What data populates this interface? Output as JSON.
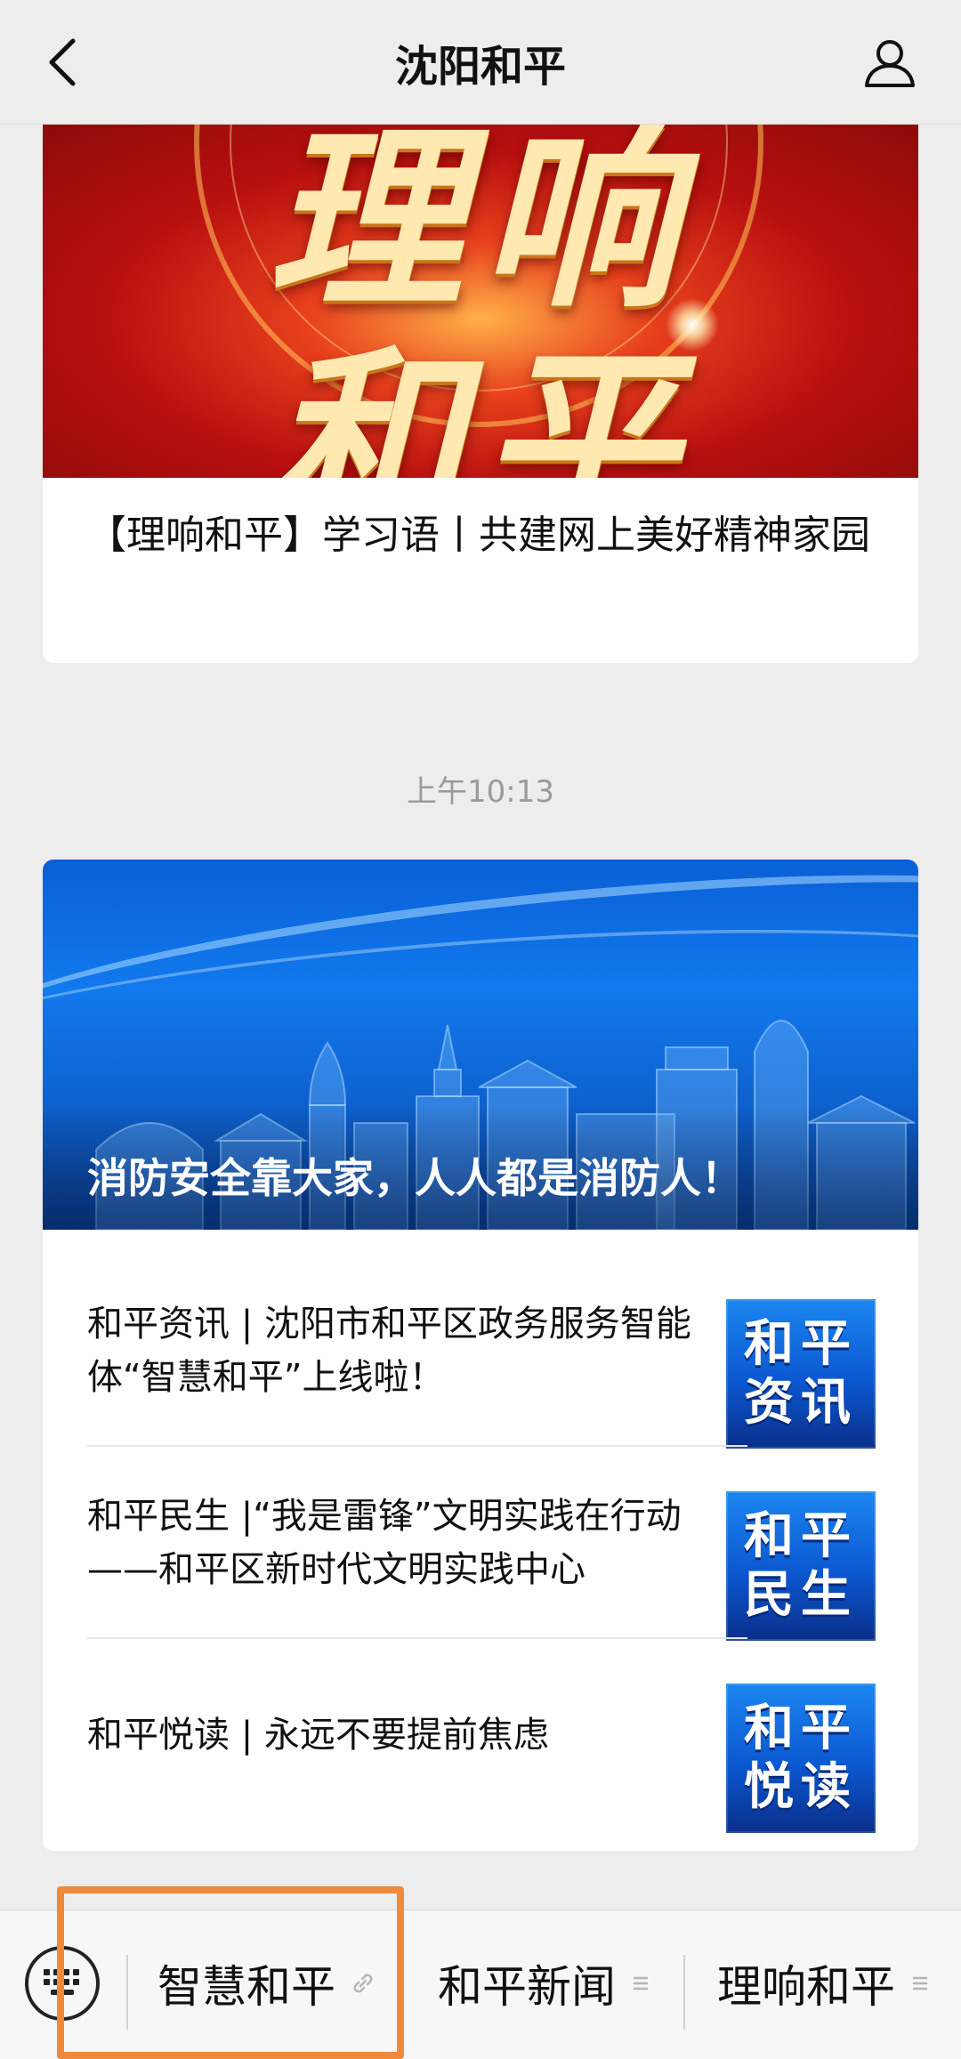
{
  "header": {
    "title": "沈阳和平",
    "back_icon": "chevron-left-icon",
    "profile_icon": "person-icon"
  },
  "article1": {
    "cover_text_line1": "理响",
    "cover_text_line2": "和平",
    "headline": "【理响和平】学习语丨共建网上美好精神家园"
  },
  "timestamp": "上午10:13",
  "article2": {
    "cover_caption": "消防安全靠大家，人人都是消防人！",
    "items": [
      {
        "title": "和平资讯 | 沈阳市和平区政务服务智能体“智慧和平”上线啦！",
        "thumb_label": "和平资讯"
      },
      {
        "title": "和平民生 |“我是雷锋”文明实践在行动——和平区新时代文明实践中心",
        "thumb_label": "和平民生"
      },
      {
        "title": "和平悦读 | 永远不要提前焦虑",
        "thumb_label": "和平悦读"
      }
    ]
  },
  "menu": {
    "keyboard_icon": "keyboard-icon",
    "items": [
      {
        "label": "智慧和平",
        "icon": "link-icon"
      },
      {
        "label": "和平新闻",
        "icon": "menu-lines-icon"
      },
      {
        "label": "理响和平",
        "icon": "menu-lines-icon"
      }
    ]
  },
  "colors": {
    "background": "#ededed",
    "highlight": "#f08a3a",
    "thumb_blue": "#0b57d0"
  }
}
